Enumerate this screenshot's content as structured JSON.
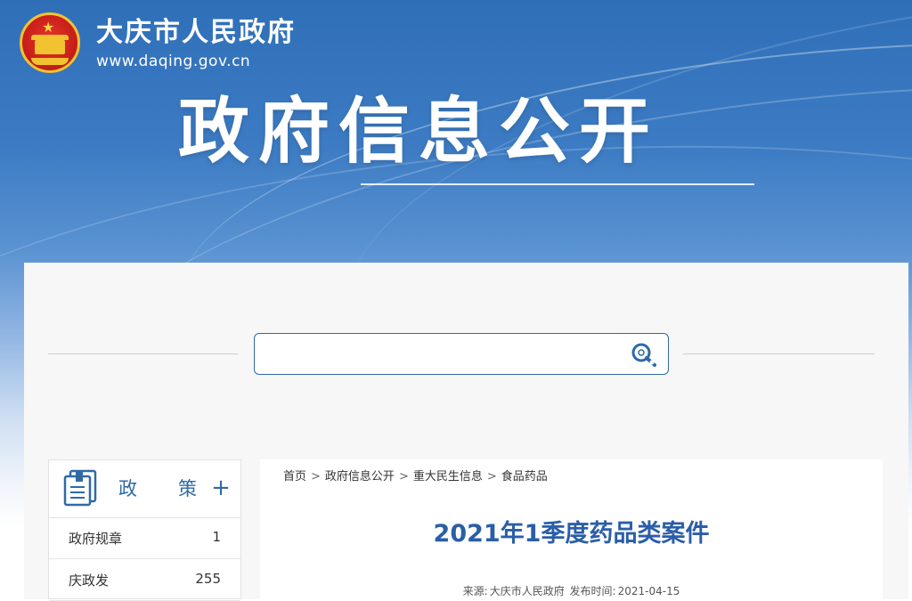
{
  "header": {
    "site_name": "大庆市人民政府",
    "site_url": "www.daqing.gov.cn",
    "page_heading": "政府信息公开"
  },
  "search": {
    "placeholder": "",
    "value": ""
  },
  "sidebar": {
    "category_chars": [
      "政",
      "策"
    ],
    "expand_symbol": "+",
    "items": [
      {
        "label": "政府规章",
        "count": "1"
      },
      {
        "label": "庆政发",
        "count": "255"
      }
    ]
  },
  "breadcrumb": {
    "items": [
      "首页",
      "政府信息公开",
      "重大民生信息",
      "食品药品"
    ],
    "separator": ">"
  },
  "article": {
    "title": "2021年1季度药品类案件",
    "source_label": "来源:",
    "source": "大庆市人民政府",
    "date_label": "发布时间:",
    "date": "2021-04-15"
  },
  "colors": {
    "brand_blue": "#2f6aa6",
    "title_blue": "#2a5ea8"
  }
}
